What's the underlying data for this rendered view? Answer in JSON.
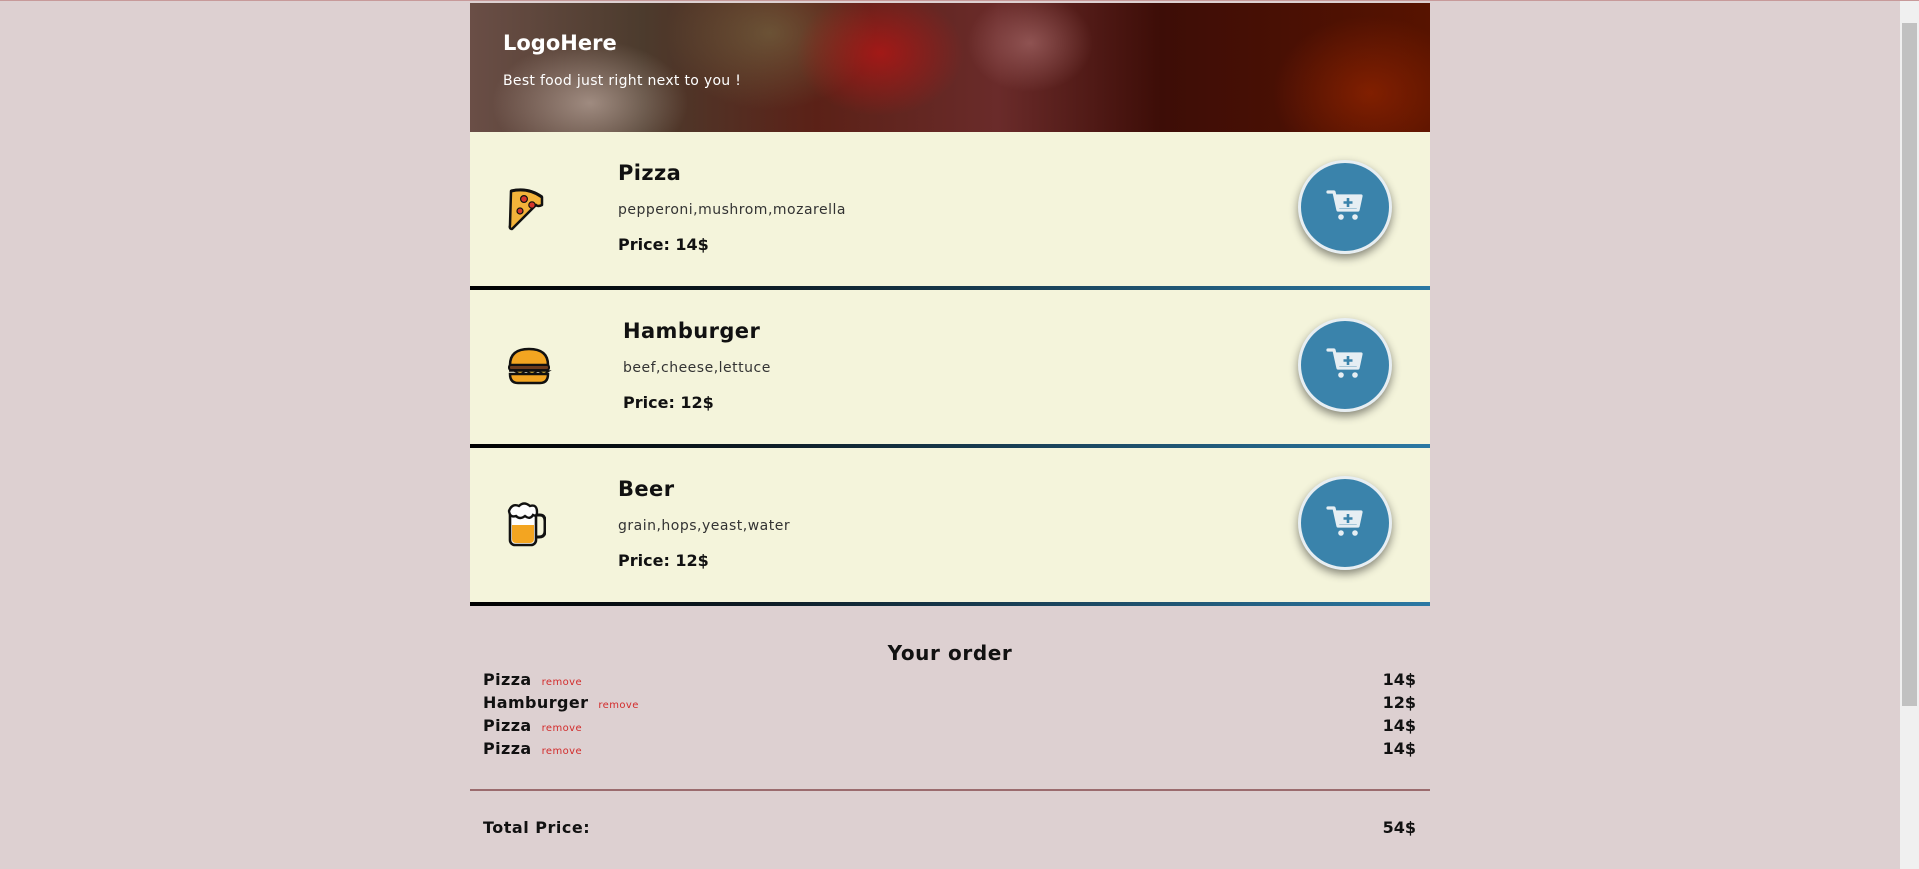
{
  "header": {
    "logo": "LogoHere",
    "tagline": "Best food just right next to you !"
  },
  "menu": {
    "items": [
      {
        "name": "Pizza",
        "ingredients": "pepperoni,mushrom,mozarella",
        "price": "Price: 14$",
        "icon": "pizza-icon"
      },
      {
        "name": "Hamburger",
        "ingredients": "beef,cheese,lettuce",
        "price": "Price: 12$",
        "icon": "hamburger-icon"
      },
      {
        "name": "Beer",
        "ingredients": "grain,hops,yeast,water",
        "price": "Price: 12$",
        "icon": "beer-icon"
      }
    ],
    "add_button_icon": "cart-plus-icon"
  },
  "order": {
    "title": "Your order",
    "remove_label": "remove",
    "rows": [
      {
        "name": "Pizza",
        "price": "14$"
      },
      {
        "name": "Hamburger",
        "price": "12$"
      },
      {
        "name": "Pizza",
        "price": "14$"
      },
      {
        "name": "Pizza",
        "price": "14$"
      }
    ],
    "total_label": "Total Price:",
    "total_value": "54$"
  },
  "colors": {
    "page_bg": "#ddd0d1",
    "card_bg": "#f4f4db",
    "button": "#3a83ab",
    "remove": "#d22b2b"
  }
}
